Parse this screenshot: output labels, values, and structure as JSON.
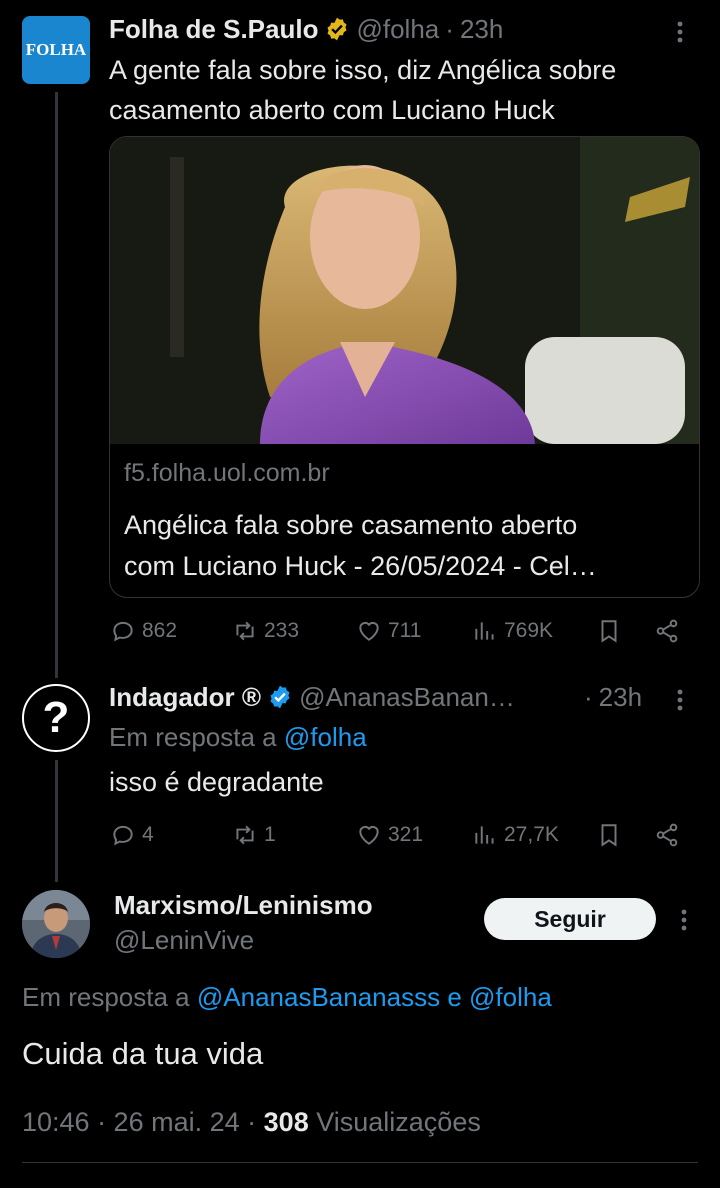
{
  "tweet1": {
    "avatar_text": "FOLHA",
    "name": "Folha de S.Paulo",
    "handle": "@folha",
    "time": "23h",
    "text_line1": "A gente fala sobre isso, diz Angélica sobre",
    "text_line2": "casamento aberto com Luciano Huck",
    "card": {
      "domain": "f5.folha.uol.com.br",
      "title_line1": "Angélica fala sobre casamento aberto",
      "title_line2": "com Luciano Huck - 26/05/2024 - Cel…"
    },
    "actions": {
      "replies": "862",
      "reposts": "233",
      "likes": "711",
      "views": "769K"
    }
  },
  "tweet2": {
    "avatar_text": "?",
    "name": "Indagador ®",
    "handle": "@AnanasBanan…",
    "time": "23h",
    "reply_prefix": "Em resposta a",
    "reply_to": "@folha",
    "text": "isso é degradante",
    "actions": {
      "replies": "4",
      "reposts": "1",
      "likes": "321",
      "views": "27,7K"
    }
  },
  "tweet3": {
    "name": "Marxismo/Leninismo",
    "handle": "@LeninVive",
    "follow_label": "Seguir",
    "reply_prefix": "Em resposta a",
    "reply_to_1": "@AnanasBananasss",
    "reply_and": "e",
    "reply_to_2": "@folha",
    "text": "Cuida da tua vida",
    "meta_time": "10:46 · 26 mai. 24 ·",
    "meta_views_count": "308",
    "meta_views_label": "Visualizações"
  },
  "colors": {
    "background": "#000000",
    "accent": "#1d9bf0",
    "muted": "#71767b",
    "verified_gold": "#e2b719"
  },
  "icons": [
    "folha-logo",
    "gold-verified-badge",
    "blue-verified-badge",
    "more-icon",
    "reply-icon",
    "repost-icon",
    "like-icon",
    "views-icon",
    "bookmark-icon",
    "share-icon"
  ]
}
